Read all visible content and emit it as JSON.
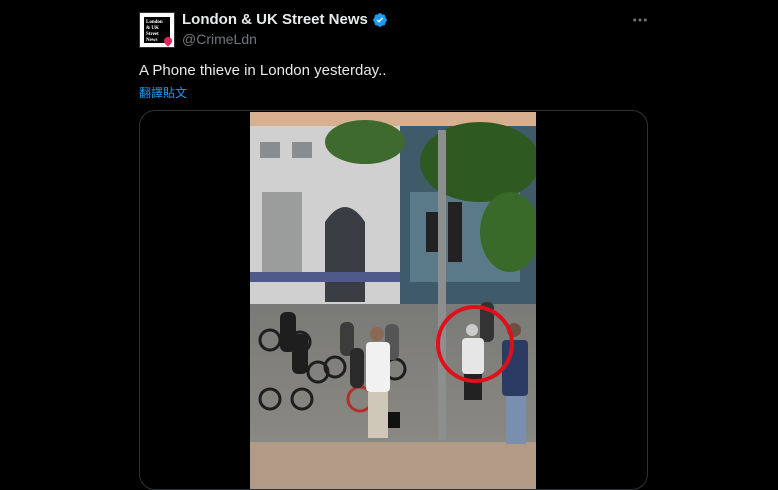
{
  "account": {
    "name": "London & UK Street News",
    "handle": "@CrimeLdn",
    "avatar_text": "London & UK Street News",
    "verified": true
  },
  "tweet": {
    "text": "A Phone thieve in London yesterday..",
    "translate_label": "翻譯貼文"
  },
  "icons": {
    "more": "more-horizontal-icon",
    "verified": "verified-badge-icon"
  },
  "colors": {
    "accent": "#1d9bf0",
    "highlight_circle": "#e0101a"
  }
}
